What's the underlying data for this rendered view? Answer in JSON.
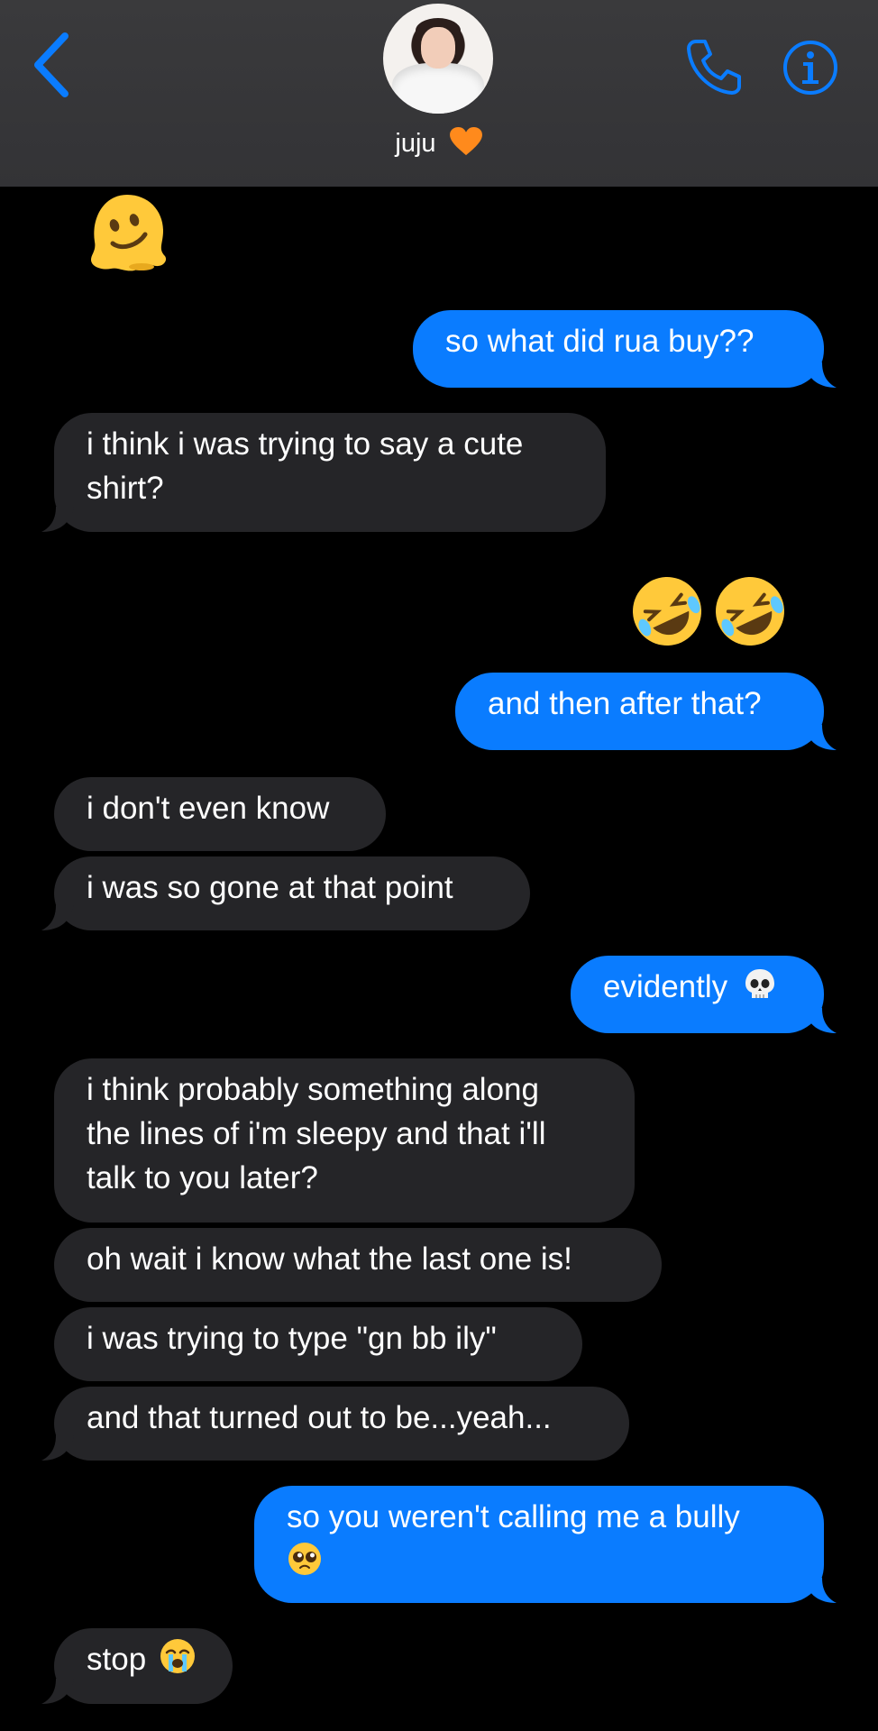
{
  "header": {
    "contact_name": "juju",
    "accent_color": "#0a7cff"
  },
  "messages": [
    {
      "id": "m1",
      "from": "them",
      "kind": "emoji",
      "emoji": "melting-face"
    },
    {
      "id": "m2",
      "from": "me",
      "text": "so what did rua buy??"
    },
    {
      "id": "m3",
      "from": "them",
      "lines": [
        "i think i was trying to say a cute",
        "shirt?"
      ]
    },
    {
      "id": "m4",
      "from": "me",
      "kind": "emoji",
      "emoji": "rolling-on-floor-laughing x2"
    },
    {
      "id": "m5",
      "from": "me",
      "text": "and then after that?"
    },
    {
      "id": "m6",
      "from": "them",
      "text": "i don't even know"
    },
    {
      "id": "m7",
      "from": "them",
      "text": "i was so gone at that point"
    },
    {
      "id": "m8",
      "from": "me",
      "text": "evidently",
      "emoji": "skull"
    },
    {
      "id": "m9",
      "from": "them",
      "lines": [
        "i think probably something along",
        "the lines of i'm sleepy and that i'll",
        "talk to you later?"
      ]
    },
    {
      "id": "m10",
      "from": "them",
      "text": "oh wait i know what the last one is!"
    },
    {
      "id": "m11",
      "from": "them",
      "text": "i was trying to type \"gn bb ily\""
    },
    {
      "id": "m12",
      "from": "them",
      "text": "and that turned out to be...yeah..."
    },
    {
      "id": "m13",
      "from": "me",
      "text": "so you weren't calling me a bully",
      "emoji": "pleading-face"
    },
    {
      "id": "m14",
      "from": "them",
      "text": "stop",
      "emoji": "loudly-crying-face"
    }
  ]
}
